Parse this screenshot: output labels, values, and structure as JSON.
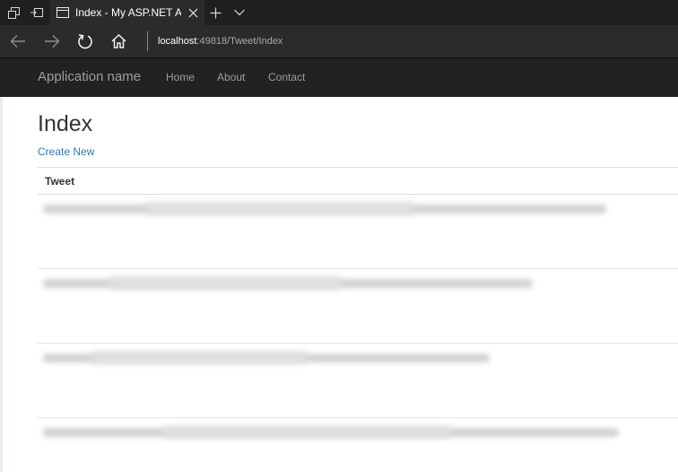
{
  "browser": {
    "tab_title": "Index - My ASP.NET Application",
    "url_host": "localhost",
    "url_path": ":49818/Tweet/Index"
  },
  "icons": {
    "tab_actions": "tab-actions-icon",
    "set_aside": "set-aside-tabs-icon",
    "page": "page-icon",
    "close_tab": "close-icon",
    "new_tab": "plus-icon",
    "tab_list": "chevron-down-icon",
    "back": "back-arrow-icon",
    "forward": "forward-arrow-icon",
    "refresh": "refresh-icon",
    "home": "home-icon"
  },
  "navbar": {
    "brand": "Application name",
    "links": [
      "Home",
      "About",
      "Contact"
    ]
  },
  "page": {
    "title": "Index",
    "create_new": "Create New"
  },
  "table": {
    "header": "Tweet",
    "rows": [
      "",
      "",
      "",
      ""
    ]
  },
  "colors": {
    "navbar_bg": "#222222",
    "nav_text": "#9d9d9d",
    "link": "#337ab7",
    "browser_chrome": "#2b2b2b"
  }
}
